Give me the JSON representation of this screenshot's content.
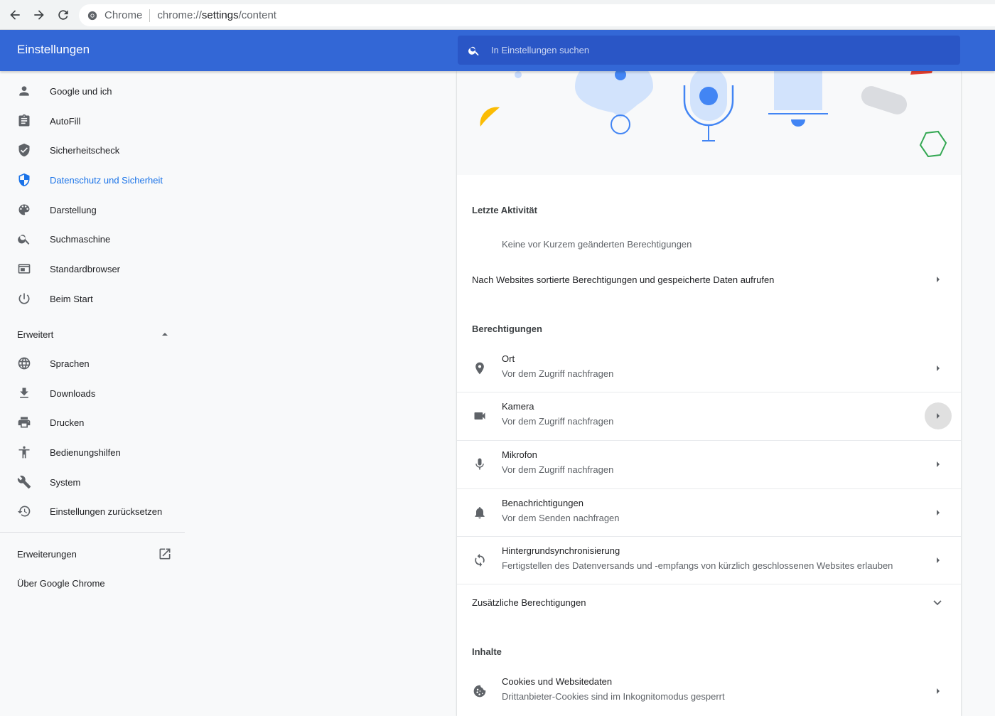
{
  "browser": {
    "site_label": "Chrome",
    "url_scheme": "chrome://",
    "url_host": "settings",
    "url_path": "/content"
  },
  "header": {
    "title": "Einstellungen",
    "search_placeholder": "In Einstellungen suchen"
  },
  "sidebar": {
    "items": [
      {
        "label": "Google und ich",
        "icon": "person-icon"
      },
      {
        "label": "AutoFill",
        "icon": "clipboard-icon"
      },
      {
        "label": "Sicherheitscheck",
        "icon": "shield-check-icon"
      },
      {
        "label": "Datenschutz und Sicherheit",
        "icon": "shield-icon",
        "active": true
      },
      {
        "label": "Darstellung",
        "icon": "palette-icon"
      },
      {
        "label": "Suchmaschine",
        "icon": "search-icon"
      },
      {
        "label": "Standardbrowser",
        "icon": "browser-icon"
      },
      {
        "label": "Beim Start",
        "icon": "power-icon"
      }
    ],
    "advanced_label": "Erweitert",
    "advanced_items": [
      {
        "label": "Sprachen",
        "icon": "globe-icon"
      },
      {
        "label": "Downloads",
        "icon": "download-icon"
      },
      {
        "label": "Drucken",
        "icon": "printer-icon"
      },
      {
        "label": "Bedienungshilfen",
        "icon": "accessibility-icon"
      },
      {
        "label": "System",
        "icon": "wrench-icon"
      },
      {
        "label": "Einstellungen zurücksetzen",
        "icon": "restore-icon"
      }
    ],
    "extensions_label": "Erweiterungen",
    "about_label": "Über Google Chrome"
  },
  "main": {
    "recent": {
      "title": "Letzte Aktivität",
      "empty_text": "Keine vor Kurzem geänderten Berechtigungen",
      "view_all_label": "Nach Websites sortierte Berechtigungen und gespeicherte Daten aufrufen"
    },
    "permissions": {
      "title": "Berechtigungen",
      "items": [
        {
          "title": "Ort",
          "subtitle": "Vor dem Zugriff nachfragen",
          "icon": "location-icon"
        },
        {
          "title": "Kamera",
          "subtitle": "Vor dem Zugriff nachfragen",
          "icon": "camera-icon"
        },
        {
          "title": "Mikrofon",
          "subtitle": "Vor dem Zugriff nachfragen",
          "icon": "microphone-icon"
        },
        {
          "title": "Benachrichtigungen",
          "subtitle": "Vor dem Senden nachfragen",
          "icon": "bell-icon"
        },
        {
          "title": "Hintergrundsynchronisierung",
          "subtitle": "Fertigstellen des Datenversands und -empfangs von kürzlich geschlossenen Websites erlauben",
          "icon": "sync-icon"
        }
      ],
      "additional_label": "Zusätzliche Berechtigungen"
    },
    "content": {
      "title": "Inhalte",
      "items": [
        {
          "title": "Cookies und Websitedaten",
          "subtitle": "Drittanbieter-Cookies sind im Inkognitomodus gesperrt",
          "icon": "cookie-icon"
        }
      ]
    }
  },
  "colors": {
    "header_blue": "#3367d6",
    "search_blue": "#2a56c6",
    "active_blue": "#1a73e8",
    "illustration_blue": "#4285f4",
    "illustration_yellow": "#fbbc04",
    "illustration_green": "#34a853",
    "illustration_red": "#ea4335"
  }
}
